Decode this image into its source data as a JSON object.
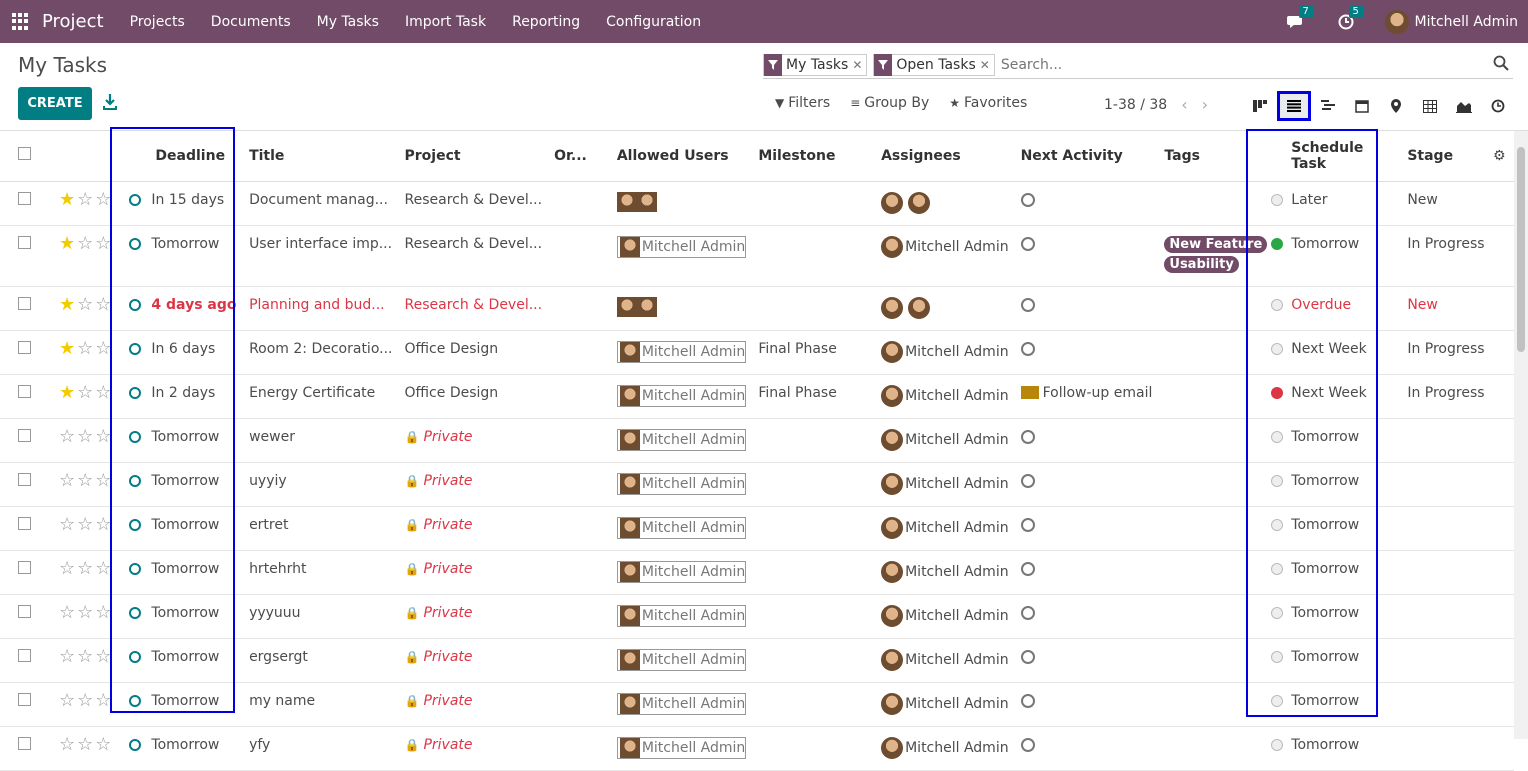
{
  "navbar": {
    "brand": "Project",
    "menu": [
      "Projects",
      "Documents",
      "My Tasks",
      "Import Task",
      "Reporting",
      "Configuration"
    ],
    "messages_count": "7",
    "activities_count": "5",
    "user_name": "Mitchell Admin"
  },
  "control": {
    "page_title": "My Tasks",
    "create_label": "CREATE",
    "facets": [
      "My Tasks",
      "Open Tasks"
    ],
    "search_placeholder": "Search...",
    "filters_label": "Filters",
    "groupby_label": "Group By",
    "favorites_label": "Favorites",
    "pager": "1-38 / 38",
    "views": [
      "kanban",
      "list",
      "gantt",
      "calendar",
      "map",
      "pivot",
      "graph",
      "activity"
    ],
    "active_view": "list"
  },
  "table": {
    "headers": {
      "deadline": "Deadline",
      "title": "Title",
      "project": "Project",
      "order": "Or...",
      "allowed_users": "Allowed Users",
      "milestone": "Milestone",
      "assignees": "Assignees",
      "next_activity": "Next Activity",
      "tags": "Tags",
      "schedule_task": "Schedule Task",
      "stage": "Stage"
    },
    "rows": [
      {
        "deadline": "In 15 days",
        "title": "Document manag...",
        "project": "Research & Devel...",
        "private": false,
        "allowed": "avatars",
        "milestone": "",
        "assignees": "avatars",
        "activity": "",
        "tags": [],
        "schedule": "Later",
        "dot": "grey",
        "stage": "New",
        "star": true,
        "overdue": false
      },
      {
        "deadline": "Tomorrow",
        "title": "User interface imp...",
        "project": "Research & Devel...",
        "private": false,
        "allowed": "Mitchell Admin",
        "milestone": "",
        "assignees": "Mitchell Admin",
        "activity": "",
        "tags": [
          "New Feature",
          "Usability"
        ],
        "schedule": "Tomorrow",
        "dot": "green",
        "stage": "In Progress",
        "star": true,
        "overdue": false
      },
      {
        "deadline": "4 days ago",
        "title": "Planning and bud...",
        "project": "Research & Devel...",
        "private": false,
        "allowed": "avatars",
        "milestone": "",
        "assignees": "avatars",
        "activity": "",
        "tags": [],
        "schedule": "Overdue",
        "dot": "grey",
        "stage": "New",
        "star": true,
        "overdue": true
      },
      {
        "deadline": "In 6 days",
        "title": "Room 2: Decoratio...",
        "project": "Office Design",
        "private": false,
        "allowed": "Mitchell Admin",
        "milestone": "Final Phase",
        "assignees": "Mitchell Admin",
        "activity": "",
        "tags": [],
        "schedule": "Next Week",
        "dot": "grey",
        "stage": "In Progress",
        "star": true,
        "overdue": false
      },
      {
        "deadline": "In 2 days",
        "title": "Energy Certificate",
        "project": "Office Design",
        "private": false,
        "allowed": "Mitchell Admin",
        "milestone": "Final Phase",
        "assignees": "Mitchell Admin",
        "activity": "Follow-up email",
        "tags": [],
        "schedule": "Next Week",
        "dot": "red",
        "stage": "In Progress",
        "star": true,
        "overdue": false
      },
      {
        "deadline": "Tomorrow",
        "title": "wewer",
        "project": "Private",
        "private": true,
        "allowed": "Mitchell Admin",
        "milestone": "",
        "assignees": "Mitchell Admin",
        "activity": "",
        "tags": [],
        "schedule": "Tomorrow",
        "dot": "grey",
        "stage": "",
        "star": false,
        "overdue": false
      },
      {
        "deadline": "Tomorrow",
        "title": "uyyiy",
        "project": "Private",
        "private": true,
        "allowed": "Mitchell Admin",
        "milestone": "",
        "assignees": "Mitchell Admin",
        "activity": "",
        "tags": [],
        "schedule": "Tomorrow",
        "dot": "grey",
        "stage": "",
        "star": false,
        "overdue": false
      },
      {
        "deadline": "Tomorrow",
        "title": "ertret",
        "project": "Private",
        "private": true,
        "allowed": "Mitchell Admin",
        "milestone": "",
        "assignees": "Mitchell Admin",
        "activity": "",
        "tags": [],
        "schedule": "Tomorrow",
        "dot": "grey",
        "stage": "",
        "star": false,
        "overdue": false
      },
      {
        "deadline": "Tomorrow",
        "title": "hrtehrht",
        "project": "Private",
        "private": true,
        "allowed": "Mitchell Admin",
        "milestone": "",
        "assignees": "Mitchell Admin",
        "activity": "",
        "tags": [],
        "schedule": "Tomorrow",
        "dot": "grey",
        "stage": "",
        "star": false,
        "overdue": false
      },
      {
        "deadline": "Tomorrow",
        "title": "yyyuuu",
        "project": "Private",
        "private": true,
        "allowed": "Mitchell Admin",
        "milestone": "",
        "assignees": "Mitchell Admin",
        "activity": "",
        "tags": [],
        "schedule": "Tomorrow",
        "dot": "grey",
        "stage": "",
        "star": false,
        "overdue": false
      },
      {
        "deadline": "Tomorrow",
        "title": "ergsergt",
        "project": "Private",
        "private": true,
        "allowed": "Mitchell Admin",
        "milestone": "",
        "assignees": "Mitchell Admin",
        "activity": "",
        "tags": [],
        "schedule": "Tomorrow",
        "dot": "grey",
        "stage": "",
        "star": false,
        "overdue": false
      },
      {
        "deadline": "Tomorrow",
        "title": "my name",
        "project": "Private",
        "private": true,
        "allowed": "Mitchell Admin",
        "milestone": "",
        "assignees": "Mitchell Admin",
        "activity": "",
        "tags": [],
        "schedule": "Tomorrow",
        "dot": "grey",
        "stage": "",
        "star": false,
        "overdue": false
      },
      {
        "deadline": "Tomorrow",
        "title": "yfy",
        "project": "Private",
        "private": true,
        "allowed": "Mitchell Admin",
        "milestone": "",
        "assignees": "Mitchell Admin",
        "activity": "",
        "tags": [],
        "schedule": "Tomorrow",
        "dot": "grey",
        "stage": "",
        "star": false,
        "overdue": false
      }
    ]
  },
  "colors": {
    "brand": "#714b67",
    "primary": "#017e84",
    "danger": "#dc3545",
    "highlight": "#0000e0",
    "star": "#f3cc00"
  }
}
